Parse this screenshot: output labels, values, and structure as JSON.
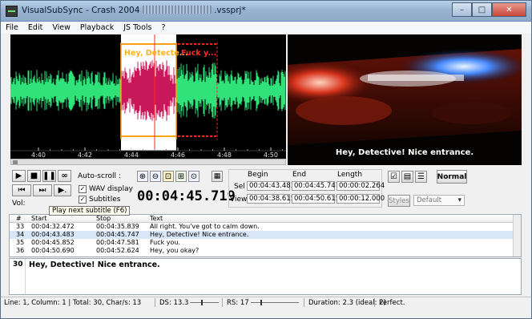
{
  "window": {
    "title": "VisualSubSync - Crash 2004",
    "title_suffix": ".vssprj*"
  },
  "menu": [
    "File",
    "Edit",
    "View",
    "Playback",
    "JS Tools",
    "?"
  ],
  "waveform": {
    "timeline_labels": [
      "4:40",
      "4:42",
      "4:44",
      "4:46",
      "4:48",
      "4:50"
    ],
    "subtitle_a": "Hey, Detecte...",
    "subtitle_b": "Fuck y...",
    "colors": {
      "wave": "#2fe27a",
      "selected_bg": "#ffffff",
      "selected_wave": "#c8185a",
      "range_a": "#ffa21a",
      "range_b": "#ff2020"
    }
  },
  "video": {
    "subtitle": "Hey, Detective! Nice entrance."
  },
  "autoscroll": {
    "label": "Auto-scroll :",
    "wav_display": "WAV display",
    "subtitles": "Subtitles",
    "vol_label": "Vol:"
  },
  "clock": "00:04:45.719",
  "timing": {
    "headers": {
      "begin": "Begin",
      "end": "End",
      "length": "Length"
    },
    "sel": {
      "label": "Sel",
      "begin": "00:04:43.483",
      "end": "00:04:45.747",
      "length": "00:00:02.264"
    },
    "view": {
      "label": "View",
      "begin": "00:04:38.615",
      "end": "00:04:50.615",
      "length": "00:00:12.000"
    }
  },
  "buttons": {
    "normal": "Normal",
    "styles": "Styles",
    "style_select": "Default"
  },
  "tooltip": "Play next subtitle (F6)",
  "table": {
    "columns": [
      "#",
      "Start",
      "Stop",
      "Text"
    ],
    "rows": [
      {
        "num": "33",
        "start": "00:04:32.472",
        "stop": "00:04:35.839",
        "text": "All right. You've got to calm down."
      },
      {
        "num": "34",
        "start": "00:04:43.483",
        "stop": "00:04:45.747",
        "text": "Hey, Detective! Nice entrance."
      },
      {
        "num": "35",
        "start": "00:04:45.852",
        "stop": "00:04:47.581",
        "text": "Fuck you."
      },
      {
        "num": "36",
        "start": "00:04:50.690",
        "stop": "00:04:52.624",
        "text": "Hey, you okay?"
      }
    ]
  },
  "editor": {
    "num": "30",
    "text": "Hey, Detective! Nice entrance."
  },
  "status": {
    "position": "Line: 1, Column: 1 | Total: 30, Char/s: 13",
    "ds": "DS: 13.3",
    "rs": "RS: 17",
    "duration": "Duration: 2.3 (ideal: 2)",
    "result": "Perfect."
  }
}
